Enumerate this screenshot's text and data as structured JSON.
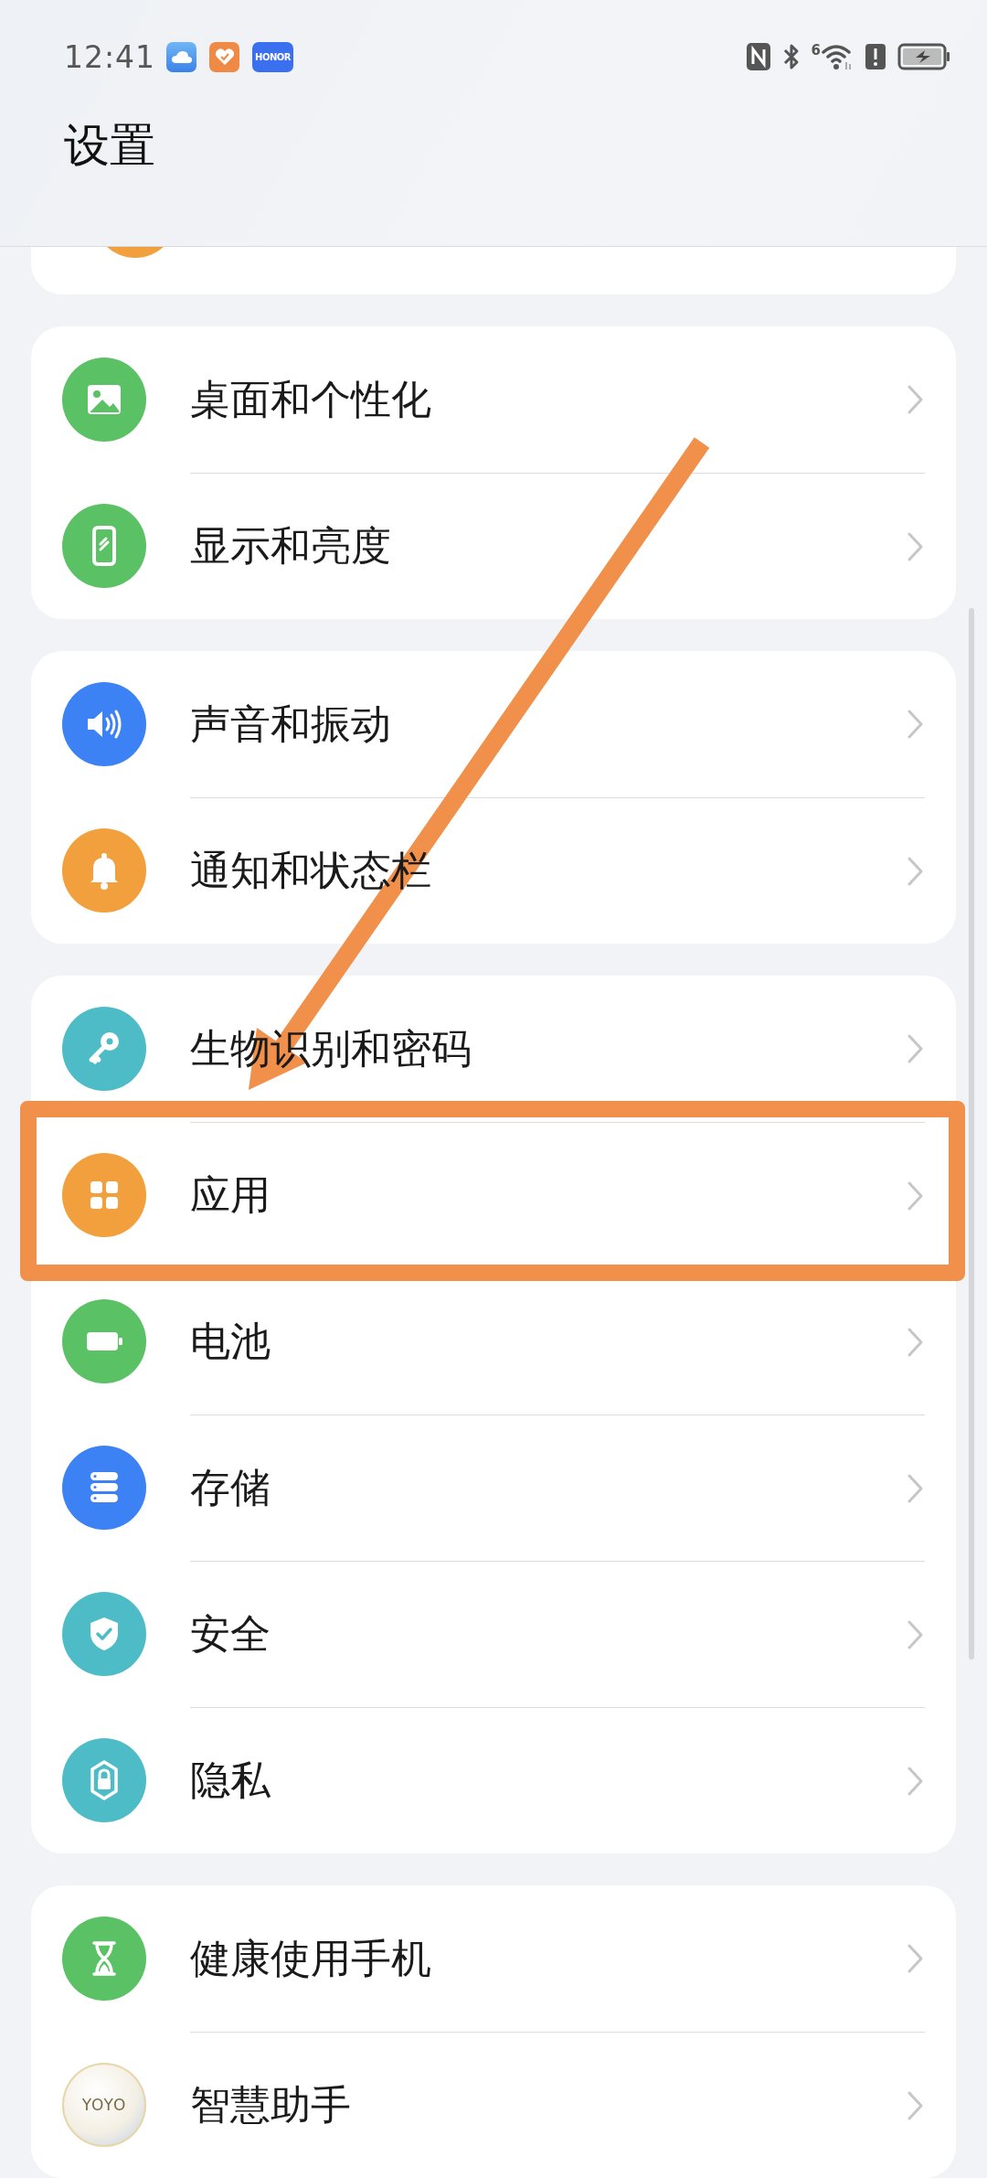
{
  "status_bar": {
    "time": "12:41",
    "notification_icons": [
      {
        "kind": "cloud"
      },
      {
        "kind": "heart"
      },
      {
        "kind": "logo",
        "text": "HONOR"
      }
    ],
    "wifi_label": "6"
  },
  "title": "设置",
  "groups": [
    {
      "items": [
        {
          "label": "桌面和个性化",
          "kind": "picture",
          "color": "#5bc165",
          "highlighted": false
        },
        {
          "label": "显示和亮度",
          "kind": "phone",
          "color": "#5bc165",
          "highlighted": false
        }
      ]
    },
    {
      "items": [
        {
          "label": "声音和振动",
          "kind": "speaker",
          "color": "#3d82f5",
          "highlighted": false
        },
        {
          "label": "通知和状态栏",
          "kind": "bell",
          "color": "#f2a03d",
          "highlighted": false
        }
      ]
    },
    {
      "items": [
        {
          "label": "生物识别和密码",
          "kind": "key",
          "color": "#4dbcc6",
          "highlighted": false
        },
        {
          "label": "应用",
          "kind": "grid",
          "color": "#f2a03d",
          "highlighted": true
        },
        {
          "label": "电池",
          "kind": "battery",
          "color": "#5bc165",
          "highlighted": false
        },
        {
          "label": "存储",
          "kind": "storage",
          "color": "#3d82f5",
          "highlighted": false
        },
        {
          "label": "安全",
          "kind": "shield",
          "color": "#4dbcc6",
          "highlighted": false
        },
        {
          "label": "隐私",
          "kind": "lock",
          "color": "#4dbcc6",
          "highlighted": false
        }
      ]
    },
    {
      "items": [
        {
          "label": "健康使用手机",
          "kind": "hourglass",
          "color": "#5bc165",
          "highlighted": false
        },
        {
          "label": "智慧助手",
          "kind": "yoyo",
          "icon_text": "YOYO",
          "highlighted": false
        }
      ]
    }
  ]
}
